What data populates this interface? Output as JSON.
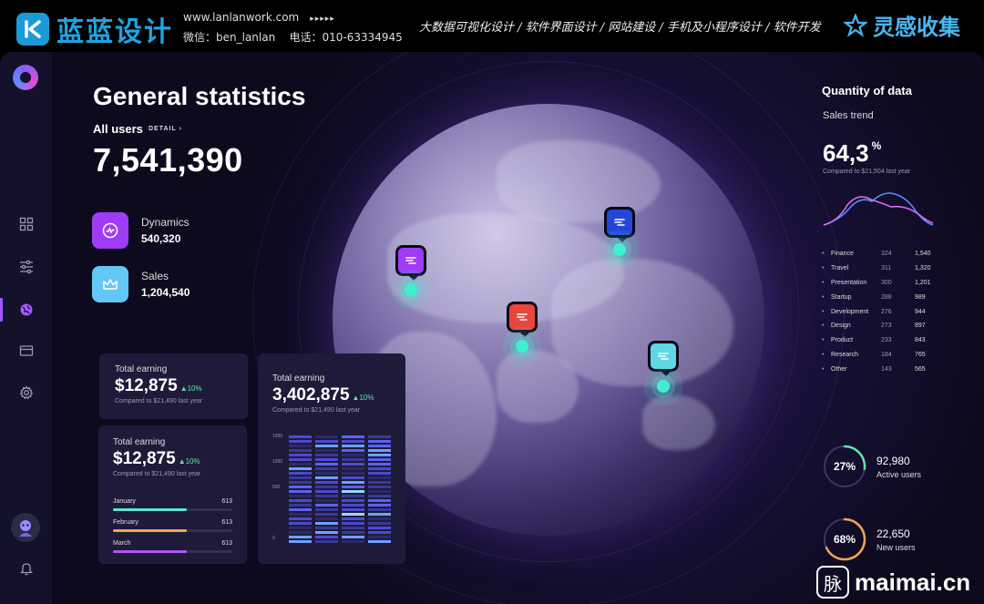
{
  "banner": {
    "brand": "蓝蓝设计",
    "website": "www.lanlanwork.com",
    "arrows": "▸▸▸▸▸",
    "wechat": "微信：ben_lanlan",
    "phone": "电话：010-63334945",
    "services": "大数据可视化设计  /  软件界面设计  /  网站建设  /  手机及小程序设计  /  软件开发",
    "collect": "灵感收集"
  },
  "main": {
    "title": "General statistics",
    "users_label": "All users",
    "detail_label": "DETAIL ›",
    "users_value": "7,541,390",
    "metrics": [
      {
        "label": "Dynamics",
        "value": "540,320",
        "icon": "activity-icon",
        "color": "#a03cf5"
      },
      {
        "label": "Sales",
        "value": "1,204,540",
        "icon": "crown-icon",
        "color": "#62c7f5"
      }
    ]
  },
  "cards": {
    "card1": {
      "label": "Total earning",
      "value": "$12,875",
      "change": "▲10%",
      "compare": "Compared to $21,490 last year"
    },
    "card2": {
      "label": "Total earning",
      "value": "$12,875",
      "change": "▲10%",
      "compare": "Compared to $21,490 last year",
      "bars": [
        {
          "label": "January",
          "value": "613",
          "fill": 0.62,
          "color": "#5ee6d2"
        },
        {
          "label": "February",
          "value": "613",
          "fill": 0.62,
          "color": "#f2a45a"
        },
        {
          "label": "March",
          "value": "613",
          "fill": 0.62,
          "color": "#b455f0"
        }
      ]
    },
    "card3": {
      "label": "Total earning",
      "value": "3,402,875",
      "change": "▲10%",
      "compare": "Compared to $21,490 last year",
      "axis": [
        "1500",
        "1000",
        "500",
        "0"
      ]
    }
  },
  "right": {
    "title": "Quantity of data",
    "subtitle": "Sales trend",
    "big_value": "64,3",
    "big_unit": "%",
    "compare": "Compared to $21,504 last year",
    "table": [
      {
        "name": "Finance",
        "v1": "324",
        "v2": "1,540"
      },
      {
        "name": "Travel",
        "v1": "311",
        "v2": "1,320"
      },
      {
        "name": "Presentation",
        "v1": "300",
        "v2": "1,201"
      },
      {
        "name": "Startup",
        "v1": "288",
        "v2": "989"
      },
      {
        "name": "Development",
        "v1": "276",
        "v2": "944"
      },
      {
        "name": "Design",
        "v1": "273",
        "v2": "897"
      },
      {
        "name": "Product",
        "v1": "233",
        "v2": "843"
      },
      {
        "name": "Research",
        "v1": "184",
        "v2": "765"
      },
      {
        "name": "Other",
        "v1": "143",
        "v2": "565"
      }
    ],
    "active": {
      "pct": "27%",
      "pct_value": 0.27,
      "value": "92,980",
      "label": "Active users",
      "color": "#5fe6a8"
    },
    "newusers": {
      "pct": "68%",
      "pct_value": 0.68,
      "value": "22,650",
      "label": "New users",
      "color": "#f2a45a"
    }
  },
  "watermark": {
    "glyph": "脉",
    "text": "maimai.cn"
  },
  "colors": {
    "accent": "#a259ff",
    "teal": "#3ff0d0",
    "panel": "#1e1b3a"
  }
}
